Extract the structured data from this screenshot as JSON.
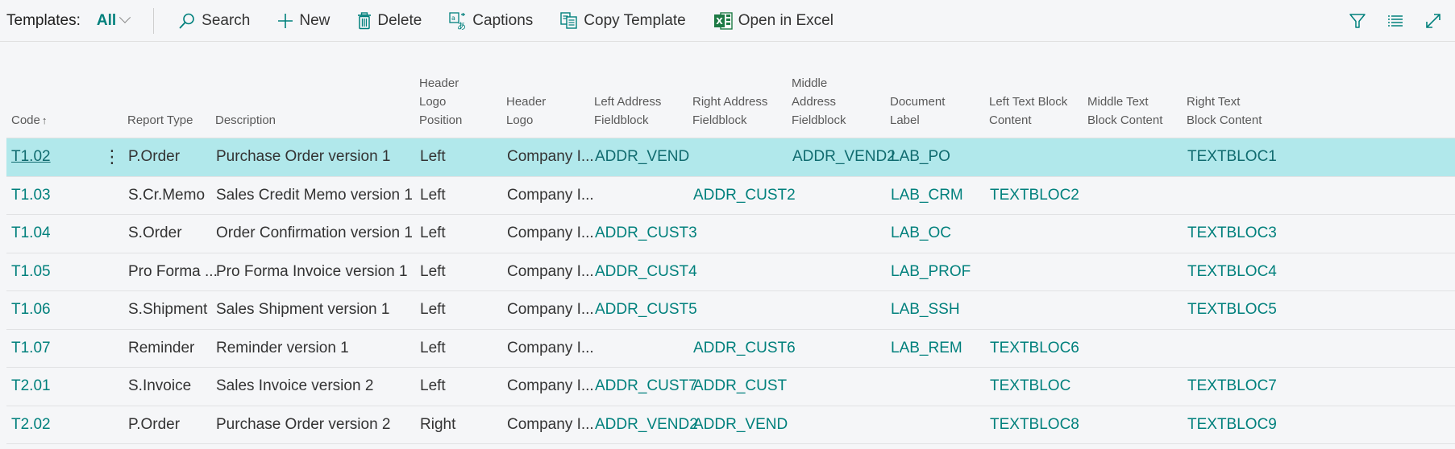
{
  "toolbar": {
    "title": "Templates:",
    "view": "All",
    "actions": {
      "search": "Search",
      "new": "New",
      "delete": "Delete",
      "captions": "Captions",
      "copy_template": "Copy Template",
      "open_in_excel": "Open in Excel"
    },
    "accent_color": "#00807c"
  },
  "table": {
    "headers": {
      "code": "Code",
      "report_type": "Report Type",
      "description": "Description",
      "header_logo_position": [
        "Header",
        "Logo",
        "Position"
      ],
      "header_logo": [
        "Header",
        "Logo"
      ],
      "left_address": [
        "Left Address",
        "Fieldblock"
      ],
      "right_address": [
        "Right Address",
        "Fieldblock"
      ],
      "middle_address": [
        "Middle",
        "Address",
        "Fieldblock"
      ],
      "document_label": [
        "Document",
        "Label"
      ],
      "left_text": [
        "Left Text Block",
        "Content"
      ],
      "middle_text": [
        "Middle Text",
        "Block Content"
      ],
      "right_text": [
        "Right Text",
        "Block Content"
      ]
    },
    "sort": {
      "column": "Code",
      "direction": "ascending"
    },
    "selected_row_color": "#b1e8eb",
    "rows": [
      {
        "code": "T1.02",
        "report_type": "P.Order",
        "description": "Purchase Order version 1",
        "logo_pos": "Left",
        "logo": "Company I...",
        "left_addr": "ADDR_VEND",
        "right_addr": "",
        "middle_addr": "ADDR_VEND2",
        "doc_label": "LAB_PO",
        "left_text": "",
        "middle_text": "",
        "right_text": "TEXTBLOC1",
        "selected": true
      },
      {
        "code": "T1.03",
        "report_type": "S.Cr.Memo",
        "description": "Sales Credit Memo version 1",
        "logo_pos": "Left",
        "logo": "Company I...",
        "left_addr": "",
        "right_addr": "ADDR_CUST2",
        "middle_addr": "",
        "doc_label": "LAB_CRM",
        "left_text": "TEXTBLOC2",
        "middle_text": "",
        "right_text": ""
      },
      {
        "code": "T1.04",
        "report_type": "S.Order",
        "description": "Order Confirmation version 1",
        "logo_pos": "Left",
        "logo": "Company I...",
        "left_addr": "ADDR_CUST3",
        "right_addr": "",
        "middle_addr": "",
        "doc_label": "LAB_OC",
        "left_text": "",
        "middle_text": "",
        "right_text": "TEXTBLOC3"
      },
      {
        "code": "T1.05",
        "report_type": "Pro Forma ...",
        "description": "Pro Forma Invoice version 1",
        "logo_pos": "Left",
        "logo": "Company I...",
        "left_addr": "ADDR_CUST4",
        "right_addr": "",
        "middle_addr": "",
        "doc_label": "LAB_PROF",
        "left_text": "",
        "middle_text": "",
        "right_text": "TEXTBLOC4"
      },
      {
        "code": "T1.06",
        "report_type": "S.Shipment",
        "description": "Sales Shipment version 1",
        "logo_pos": "Left",
        "logo": "Company I...",
        "left_addr": "ADDR_CUST5",
        "right_addr": "",
        "middle_addr": "",
        "doc_label": "LAB_SSH",
        "left_text": "",
        "middle_text": "",
        "right_text": "TEXTBLOC5"
      },
      {
        "code": "T1.07",
        "report_type": "Reminder",
        "description": "Reminder version 1",
        "logo_pos": "Left",
        "logo": "Company I...",
        "left_addr": "",
        "right_addr": "ADDR_CUST6",
        "middle_addr": "",
        "doc_label": "LAB_REM",
        "left_text": "TEXTBLOC6",
        "middle_text": "",
        "right_text": ""
      },
      {
        "code": "T2.01",
        "report_type": "S.Invoice",
        "description": "Sales Invoice version 2",
        "logo_pos": "Left",
        "logo": "Company I...",
        "left_addr": "ADDR_CUST7",
        "right_addr": "ADDR_CUST",
        "middle_addr": "",
        "doc_label": "",
        "left_text": "TEXTBLOC",
        "middle_text": "",
        "right_text": "TEXTBLOC7"
      },
      {
        "code": "T2.02",
        "report_type": "P.Order",
        "description": "Purchase Order version 2",
        "logo_pos": "Right",
        "logo": "Company I...",
        "left_addr": "ADDR_VEND2",
        "right_addr": "ADDR_VEND",
        "middle_addr": "",
        "doc_label": "",
        "left_text": "TEXTBLOC8",
        "middle_text": "",
        "right_text": "TEXTBLOC9"
      }
    ]
  }
}
